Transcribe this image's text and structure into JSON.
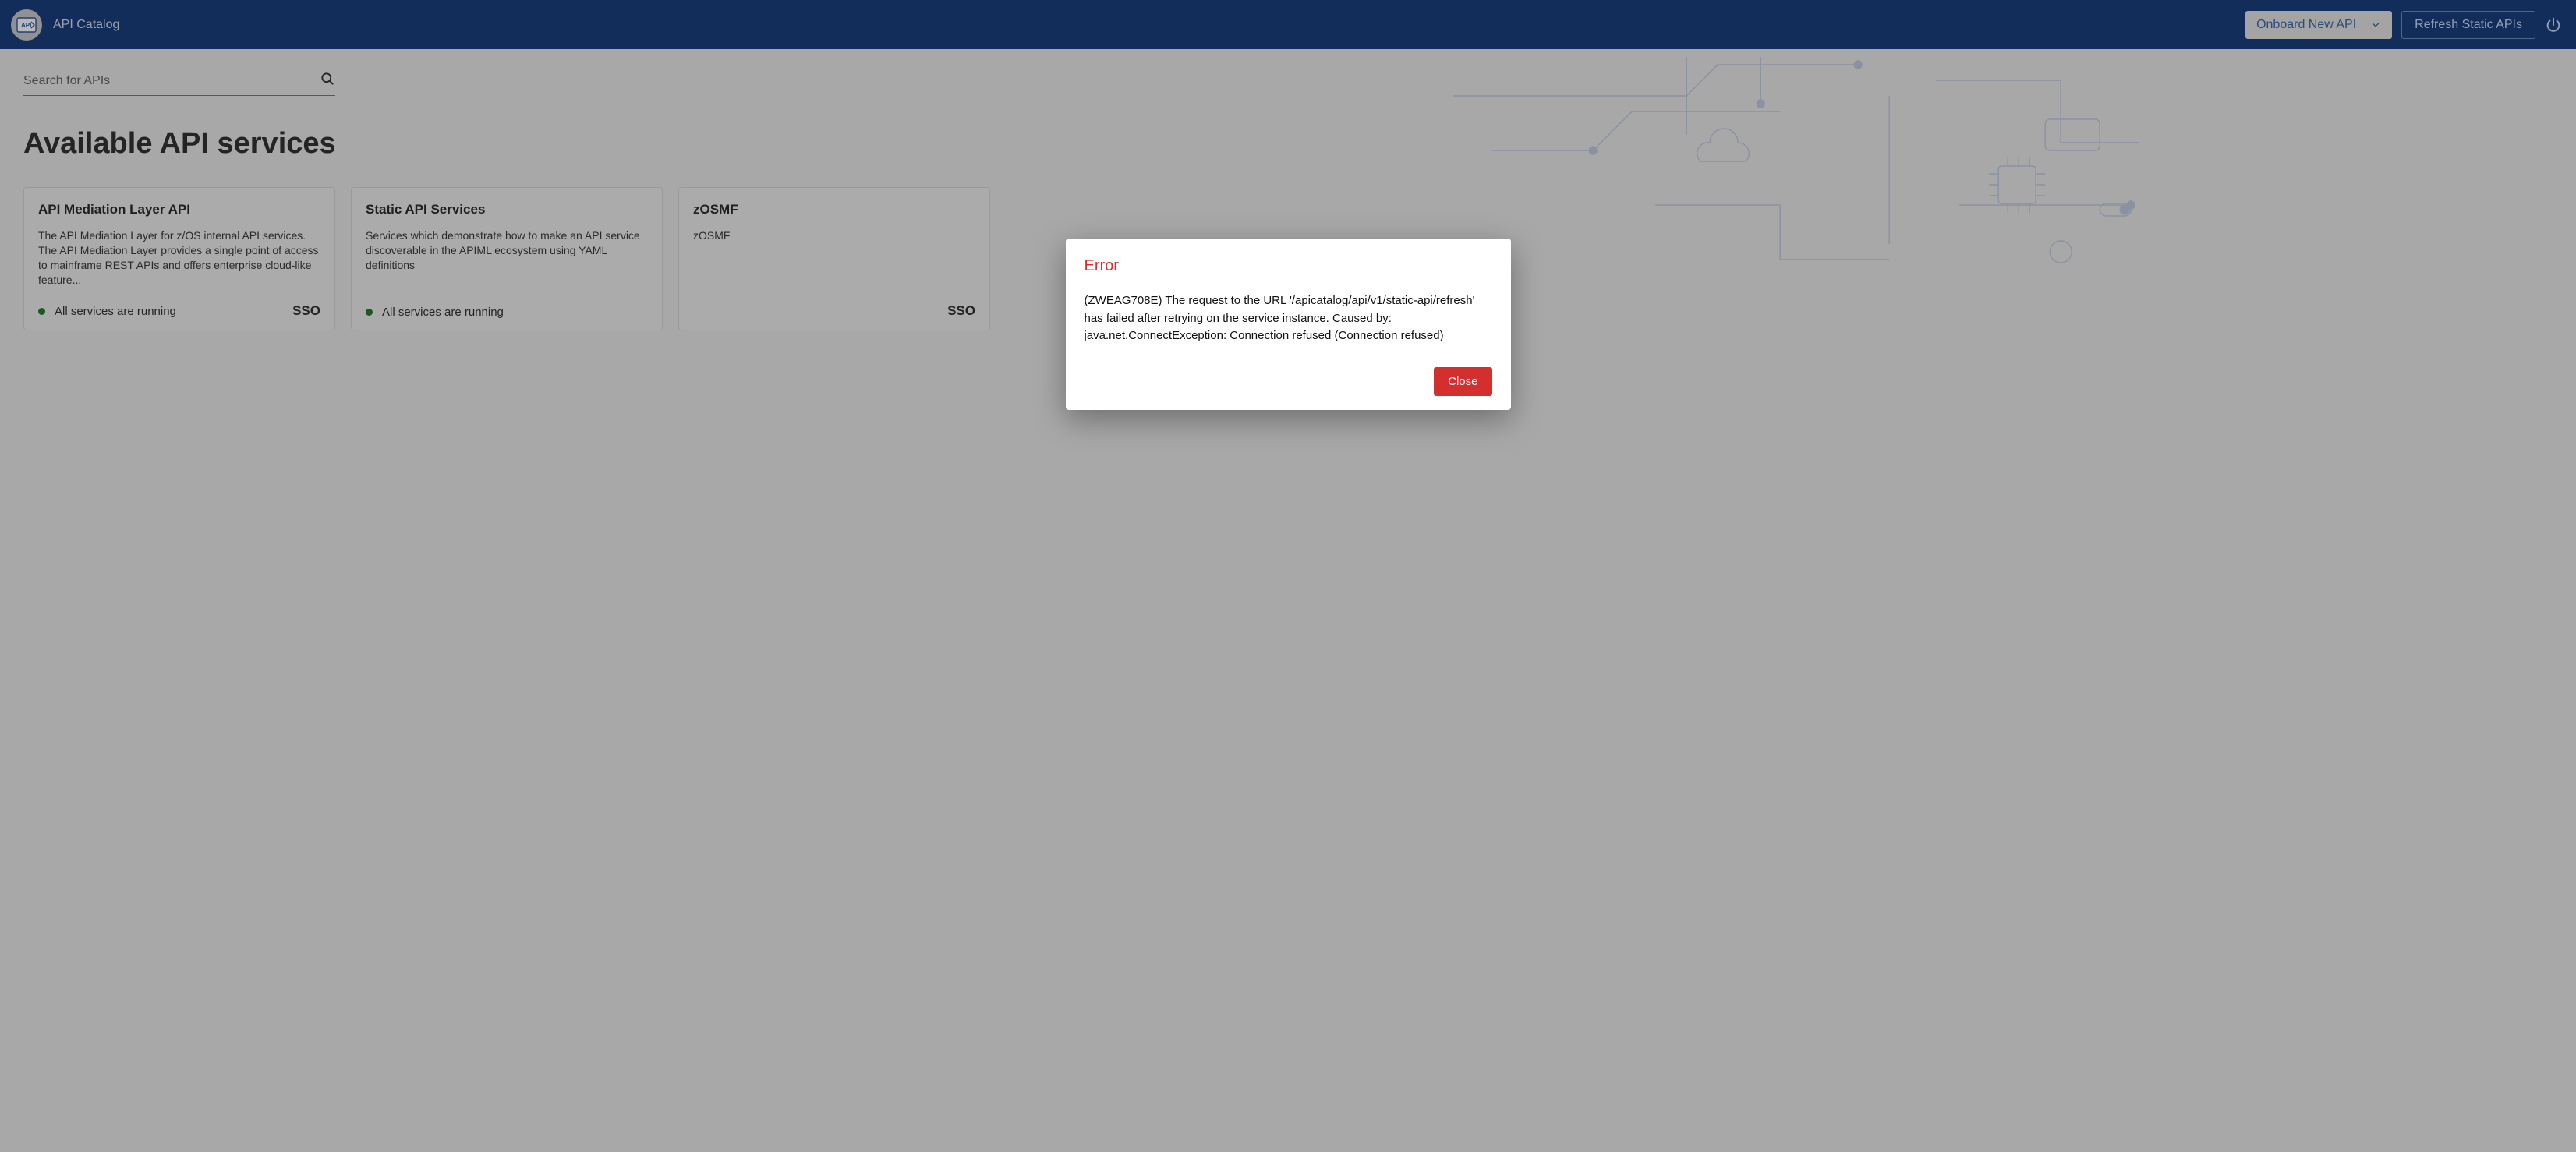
{
  "header": {
    "app_title": "API Catalog",
    "onboard_label": "Onboard New API",
    "refresh_label": "Refresh Static APIs"
  },
  "search": {
    "placeholder": "Search for APIs"
  },
  "main": {
    "page_title": "Available API services"
  },
  "cards": [
    {
      "title": "API Mediation Layer API",
      "desc": "The API Mediation Layer for z/OS internal API services. The API Mediation Layer provides a single point of access to mainframe REST APIs and offers enterprise cloud-like feature...",
      "status": "All services are running",
      "sso": "SSO"
    },
    {
      "title": "Static API Services",
      "desc": "Services which demonstrate how to make an API service discoverable in the APIML ecosystem using YAML definitions",
      "status": "All services are running",
      "sso": ""
    },
    {
      "title": "zOSMF",
      "desc": "zOSMF",
      "status": "",
      "sso": "SSO"
    }
  ],
  "modal": {
    "title": "Error",
    "body": "(ZWEAG708E) The request to the URL '/apicatalog/api/v1/static-api/refresh' has failed after retrying on the service instance. Caused by: java.net.ConnectException: Connection refused (Connection refused)",
    "close_label": "Close"
  }
}
